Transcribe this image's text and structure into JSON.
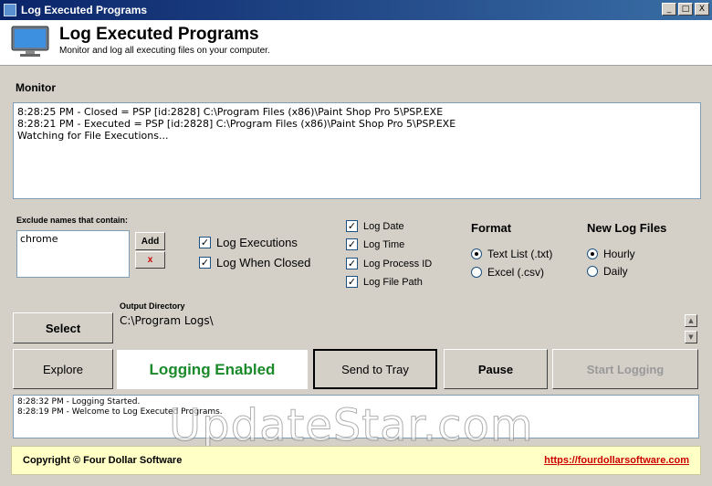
{
  "window": {
    "title": "Log Executed Programs",
    "minimize": "_",
    "maximize": "□",
    "close": "X"
  },
  "header": {
    "title": "Log Executed Programs",
    "subtitle": "Monitor and log all executing files on your computer."
  },
  "monitor": {
    "label": "Monitor",
    "lines": [
      "8:28:25 PM - Closed = PSP [id:2828] C:\\Program Files (x86)\\Paint Shop Pro 5\\PSP.EXE",
      "8:28:21 PM - Executed = PSP [id:2828] C:\\Program Files (x86)\\Paint Shop Pro 5\\PSP.EXE",
      "Watching for File Executions..."
    ]
  },
  "exclude": {
    "label": "Exclude names that contain:",
    "items": [
      "chrome"
    ],
    "add_label": "Add",
    "remove_label": "x"
  },
  "options": {
    "log_executions": {
      "label": "Log Executions",
      "checked": true
    },
    "log_when_closed": {
      "label": "Log When Closed",
      "checked": true
    },
    "log_date": {
      "label": "Log Date",
      "checked": true
    },
    "log_time": {
      "label": "Log Time",
      "checked": true
    },
    "log_process_id": {
      "label": "Log Process ID",
      "checked": true
    },
    "log_file_path": {
      "label": "Log File Path",
      "checked": true
    }
  },
  "format": {
    "label": "Format",
    "options": [
      {
        "label": "Text List (.txt)",
        "selected": true
      },
      {
        "label": "Excel (.csv)",
        "selected": false
      }
    ]
  },
  "new_log_files": {
    "label": "New Log Files",
    "options": [
      {
        "label": "Hourly",
        "selected": true
      },
      {
        "label": "Daily",
        "selected": false
      }
    ]
  },
  "output": {
    "label": "Output Directory",
    "path": "C:\\Program Logs\\",
    "select_label": "Select"
  },
  "actions": {
    "explore": "Explore",
    "status": "Logging Enabled",
    "send_to_tray": "Send to Tray",
    "pause": "Pause",
    "start_logging": "Start Logging"
  },
  "events": [
    "8:28:32 PM - Logging Started.",
    "8:28:19 PM - Welcome to Log Executed Programs."
  ],
  "watermark": "UpdateStar.com",
  "footer": {
    "copyright": "Copyright © Four Dollar Software",
    "site": "https://fourdollarsoftware.com"
  },
  "colors": {
    "status_green": "#1a8a2a",
    "footer_bg": "#ffffc6",
    "link_red": "#cc0000"
  }
}
